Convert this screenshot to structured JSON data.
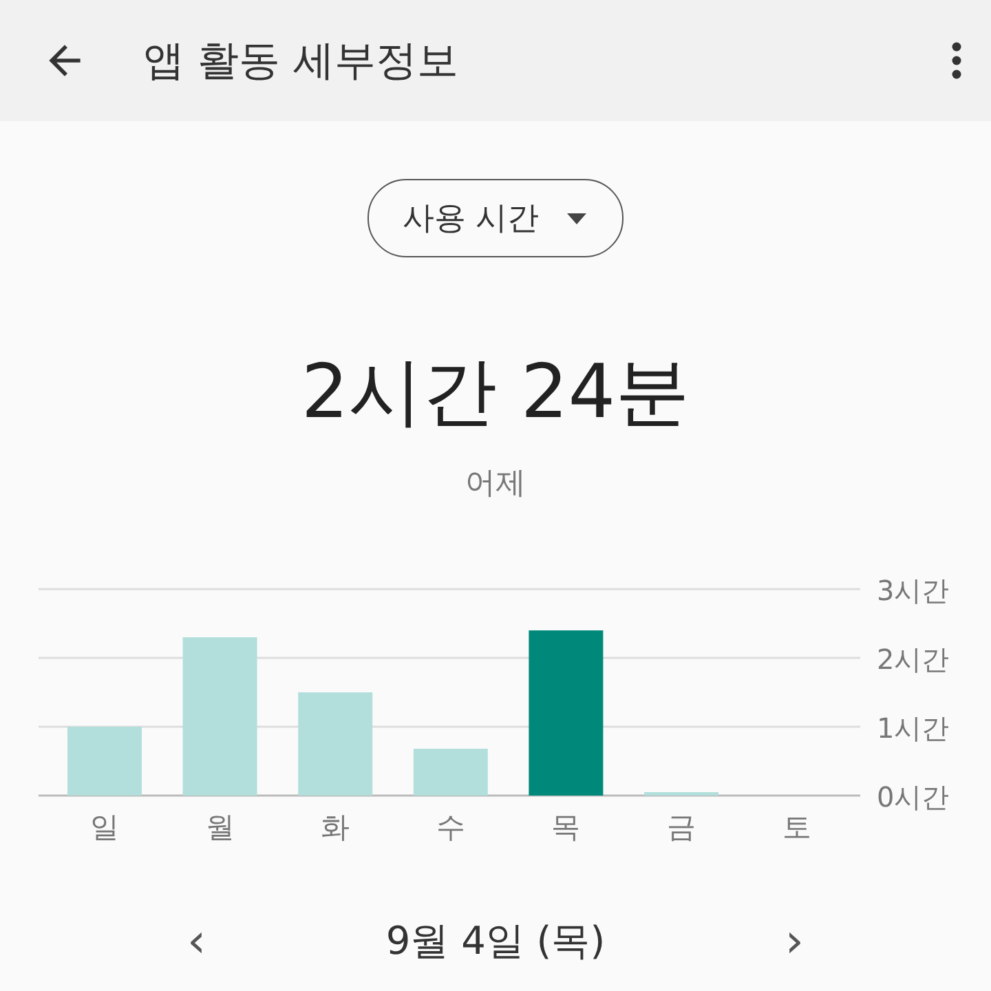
{
  "app_bar": {
    "title": "앱 활동 세부정보"
  },
  "dropdown": {
    "value": "사용 시간"
  },
  "summary": {
    "total": "2시간 24분",
    "period": "어제"
  },
  "chart": {
    "chart_data": {
      "type": "bar",
      "categories": [
        "일",
        "월",
        "화",
        "수",
        "목",
        "금",
        "토"
      ],
      "stacked": true,
      "series": [
        {
          "color": "#b2dfdb",
          "values": [
            1.0,
            2.3,
            1.5,
            0.68,
            null,
            0.05,
            0
          ]
        },
        {
          "color": "#00897b",
          "values": [
            null,
            null,
            null,
            null,
            2.4,
            null,
            null
          ]
        }
      ],
      "ylim": [
        0,
        3
      ],
      "yticks": [
        {
          "value": 0,
          "label": "0시간"
        },
        {
          "value": 1,
          "label": "1시간"
        },
        {
          "value": 2,
          "label": "2시간"
        },
        {
          "value": 3,
          "label": "3시간"
        }
      ]
    }
  },
  "date_nav": {
    "prev": "‹",
    "label": "9월 4일 (목)",
    "next": "›"
  }
}
